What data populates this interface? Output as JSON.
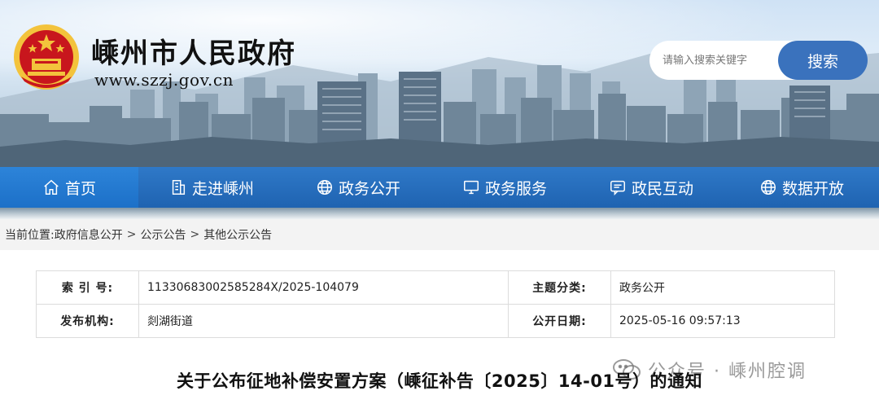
{
  "header": {
    "site_title": "嵊州市人民政府",
    "site_url": "www.szzj.gov.cn",
    "search_placeholder": "请输入搜索关键字",
    "search_button": "搜索"
  },
  "nav": {
    "items": [
      {
        "label": "首页",
        "icon": "home-icon",
        "active": true
      },
      {
        "label": "走进嵊州",
        "icon": "building-icon"
      },
      {
        "label": "政务公开",
        "icon": "globe-icon"
      },
      {
        "label": "政务服务",
        "icon": "monitor-icon"
      },
      {
        "label": "政民互动",
        "icon": "chat-icon"
      },
      {
        "label": "数据开放",
        "icon": "globe-icon"
      }
    ]
  },
  "breadcrumb": {
    "prefix": "当前位置:",
    "items": [
      "政府信息公开",
      "公示公告",
      "其他公示公告"
    ],
    "separator": ">"
  },
  "info": {
    "index_label": "索 引 号:",
    "index_value": "11330683002585284X/2025-104079",
    "category_label": "主题分类:",
    "category_value": "政务公开",
    "publisher_label": "发布机构:",
    "publisher_value": "剡湖街道",
    "date_label": "公开日期:",
    "date_value": "2025-05-16 09:57:13"
  },
  "article": {
    "title": "关于公布征地补偿安置方案（嵊征补告〔2025〕14-01号）的通知"
  },
  "watermark": {
    "text": "公众号 · 嵊州腔调"
  },
  "colors": {
    "nav_blue": "#1f63b1",
    "search_button": "#3a72bd",
    "emblem_red": "#c8161d",
    "emblem_gold": "#f3c33c"
  }
}
